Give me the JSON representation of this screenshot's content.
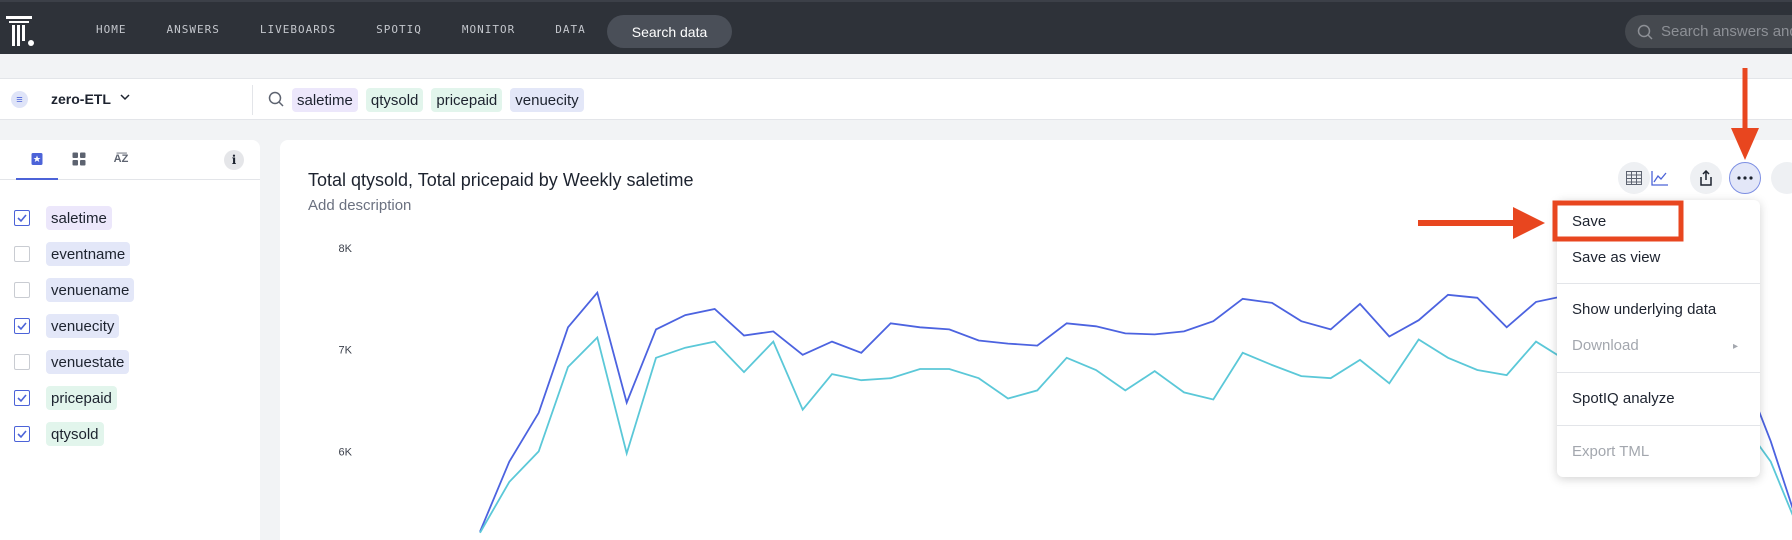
{
  "nav": {
    "items": [
      "HOME",
      "ANSWERS",
      "LIVEBOARDS",
      "SPOTIQ",
      "MONITOR",
      "DATA"
    ],
    "search_button": "Search data",
    "global_search_placeholder": "Search answers and"
  },
  "searchbar": {
    "datasource": "zero-ETL",
    "tokens": [
      "saletime",
      "qtysold",
      "pricepaid",
      "venuecity"
    ]
  },
  "leftpanel": {
    "info_label": "i",
    "columns": [
      {
        "name": "saletime",
        "checked": true
      },
      {
        "name": "eventname",
        "checked": false
      },
      {
        "name": "venuename",
        "checked": false
      },
      {
        "name": "venuecity",
        "checked": true
      },
      {
        "name": "venuestate",
        "checked": false
      },
      {
        "name": "pricepaid",
        "checked": true
      },
      {
        "name": "qtysold",
        "checked": true
      }
    ]
  },
  "card": {
    "title": "Total qtysold, Total pricepaid by Weekly saletime",
    "description": "Add description"
  },
  "menu": {
    "items": {
      "save": "Save",
      "save_as_view": "Save as view",
      "show_underlying_data": "Show underlying data",
      "download": "Download",
      "spotiq_analyze": "SpotIQ analyze",
      "export_tml": "Export TML"
    }
  },
  "colors": {
    "nav_bg": "#2e3239",
    "accent": "#4c63d8",
    "series_1": "#4c63e0",
    "series_2": "#5bc8d8",
    "annotation": "#e8461f"
  },
  "chart_data": {
    "type": "line",
    "title": "Total qtysold, Total pricepaid by Weekly saletime",
    "yticks": [
      "8K",
      "7K",
      "6K"
    ],
    "ylim": [
      5200,
      8200
    ],
    "series": [
      {
        "values": [
          5210,
          5900,
          6380,
          7220,
          7560,
          6480,
          7200,
          7340,
          7400,
          7140,
          7180,
          6950,
          7080,
          6970,
          7260,
          7220,
          7200,
          7090,
          7060,
          7040,
          7260,
          7230,
          7160,
          7150,
          7180,
          7280,
          7500,
          7460,
          7280,
          7200,
          7450,
          7130,
          7290,
          7540,
          7510,
          7220,
          7470,
          7530,
          7540,
          7440,
          7480,
          7320,
          7160,
          6840,
          6100,
          5220
        ]
      },
      {
        "values": [
          5200,
          5700,
          6000,
          6830,
          7120,
          5980,
          6920,
          7020,
          7080,
          6780,
          7080,
          6410,
          6760,
          6700,
          6720,
          6810,
          6810,
          6720,
          6520,
          6600,
          6920,
          6800,
          6600,
          6790,
          6580,
          6510,
          6970,
          6850,
          6740,
          6720,
          6900,
          6670,
          7100,
          6920,
          6800,
          6750,
          7080,
          6900,
          6940,
          7000,
          6800,
          6720,
          6620,
          6300,
          5900,
          5200
        ]
      }
    ]
  }
}
